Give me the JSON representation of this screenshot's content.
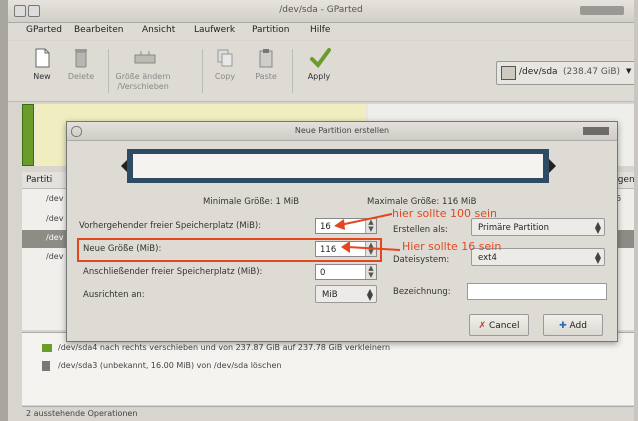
{
  "window": {
    "title": "/dev/sda - GParted"
  },
  "menu": [
    "GParted",
    "Bearbeiten",
    "Ansicht",
    "Laufwerk",
    "Partition",
    "Hilfe"
  ],
  "toolbar": {
    "new": "New",
    "delete": "Delete",
    "resize_l1": "Größe ändern",
    "resize_l2": "/Verschieben",
    "copy": "Copy",
    "paste": "Paste",
    "apply": "Apply",
    "device": "/dev/sda",
    "device_size": "(238.47 GiB)"
  },
  "partition_list": {
    "col_partition": "Partiti",
    "col_flags": "ngen",
    "rows": [
      "/dev",
      "/dev",
      "/dev",
      "/dev"
    ],
    "side_value": "6"
  },
  "dialog": {
    "title": "Neue Partition erstellen",
    "min_size": "Minimale Größe: 1 MiB",
    "max_size": "Maximale Größe: 116 MiB",
    "preceding_label": "Vorhergehender freier Speicherplatz (MiB):",
    "preceding_value": "16",
    "new_size_label": "Neue Größe (MiB):",
    "new_size_value": "116",
    "following_label": "Anschließender freier Speicherplatz (MiB):",
    "following_value": "0",
    "align_label": "Ausrichten an:",
    "align_value": "MiB",
    "create_as_label": "Erstellen als:",
    "create_as_value": "Primäre Partition",
    "filesystem_label": "Dateisystem:",
    "filesystem_value": "ext4",
    "label_label": "Bezeichnung:",
    "cancel": "Cancel",
    "add": "Add"
  },
  "annotations": {
    "preceding_note": "hier sollte 100 sein",
    "size_note": "Hier sollte 16 sein",
    "color": "#e4471f"
  },
  "operations": {
    "items": [
      "/dev/sda4 nach rechts verschieben und von 237.87 GiB auf 237.78 GiB verkleinern",
      "/dev/sda3 (unbekannt, 16.00 MiB) von /dev/sda löschen"
    ]
  },
  "status": {
    "text": "2 ausstehende Operationen"
  }
}
